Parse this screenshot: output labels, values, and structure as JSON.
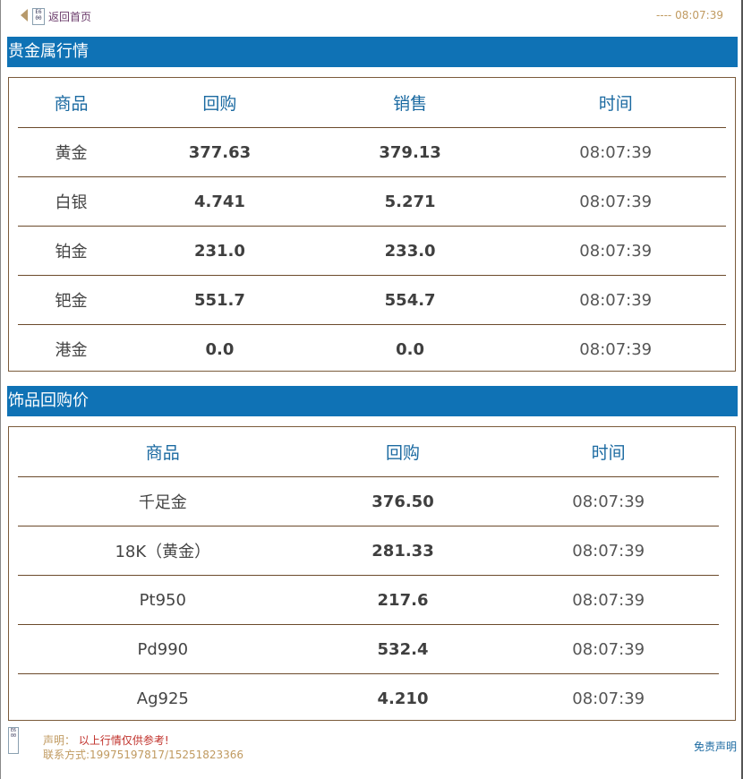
{
  "topbar": {
    "back_label": "返回首页",
    "qr_text": "E6 00",
    "time_prefix": "----",
    "time": "08:07:39"
  },
  "precious_metals": {
    "title": "贵金属行情",
    "headers": [
      "商品",
      "回购",
      "销售",
      "时间"
    ],
    "rows": [
      {
        "name": "黄金",
        "buy": "377.63",
        "sell": "379.13",
        "time": "08:07:39"
      },
      {
        "name": "白银",
        "buy": "4.741",
        "sell": "5.271",
        "time": "08:07:39"
      },
      {
        "name": "铂金",
        "buy": "231.0",
        "sell": "233.0",
        "time": "08:07:39"
      },
      {
        "name": "钯金",
        "buy": "551.7",
        "sell": "554.7",
        "time": "08:07:39"
      },
      {
        "name": "港金",
        "buy": "0.0",
        "sell": "0.0",
        "time": "08:07:39"
      }
    ]
  },
  "jewelry_buyback": {
    "title": "饰品回购价",
    "headers": [
      "商品",
      "回购",
      "时间"
    ],
    "rows": [
      {
        "name": "千足金",
        "buy": "376.50",
        "time": "08:07:39"
      },
      {
        "name": "18K（黄金）",
        "buy": "281.33",
        "time": "08:07:39"
      },
      {
        "name": "Pt950",
        "buy": "217.6",
        "time": "08:07:39"
      },
      {
        "name": "Pd990",
        "buy": "532.4",
        "time": "08:07:39"
      },
      {
        "name": "Ag925",
        "buy": "4.210",
        "time": "08:07:39"
      }
    ]
  },
  "footer": {
    "statement_label": "声明：",
    "statement_text": "以上行情仅供参考!",
    "contact": "联系方式:19975197817/15251823366",
    "disclaimer_link": "免责声明",
    "qr_text": "E6 00"
  },
  "colors": {
    "header_bg": "#0f72b5",
    "header_text": "#1b6aa1",
    "border": "#7b5b3b",
    "accent_gold": "#c09a60",
    "warning_red": "#c0302a"
  }
}
